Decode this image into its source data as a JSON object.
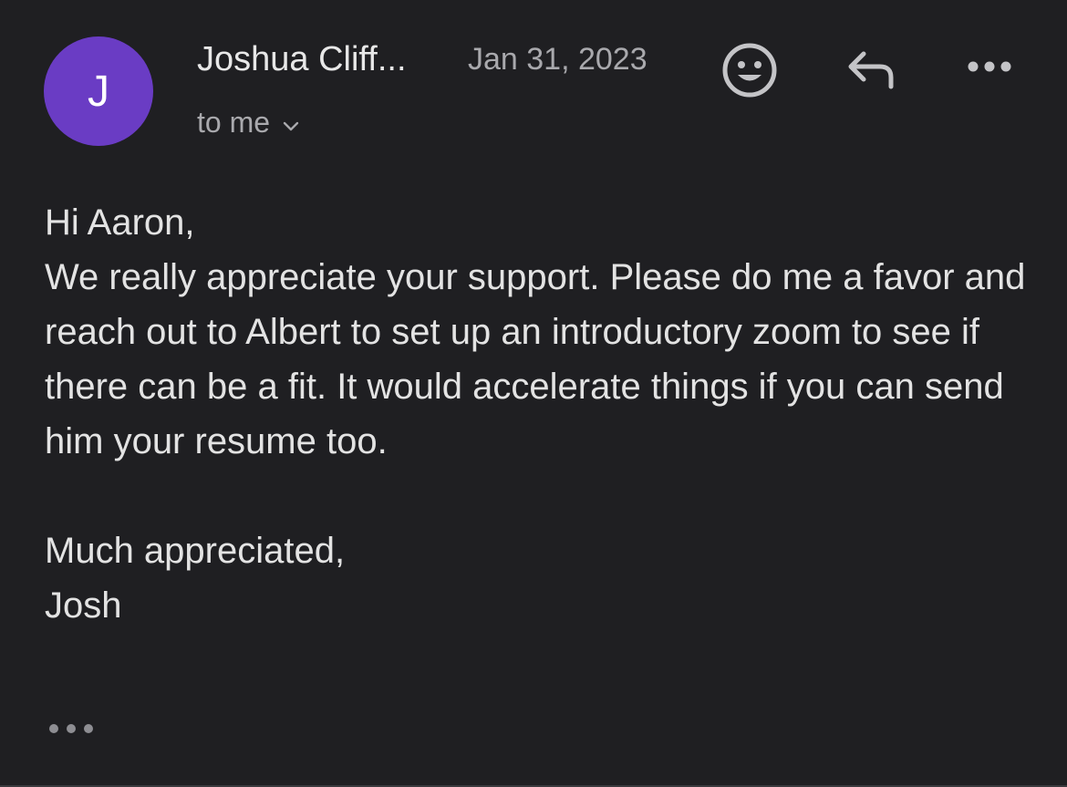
{
  "message": {
    "avatar_initial": "J",
    "sender_name": "Joshua Cliff...",
    "date": "Jan 31, 2023",
    "recipient_label": "to me",
    "body": {
      "greeting": "Hi Aaron,",
      "paragraph": "We really appreciate your support. Please do me a favor and reach out to Albert to set up an introductory zoom to see if there can be a fit. It would accelerate things if you can send him your resume too.",
      "closing": "Much appreciated,",
      "signature": "Josh"
    }
  },
  "icons": {
    "emoji_reaction": "smiley-face-icon",
    "reply": "reply-arrow-icon",
    "more": "more-options-icon",
    "recipient_toggle": "chevron-down-icon",
    "trimmed_content": "ellipsis-icon"
  },
  "colors": {
    "background": "#1f1f22",
    "avatar": "#6a3cc4",
    "primary_text": "#e3e3e3",
    "secondary_text": "#a9a9ad"
  }
}
